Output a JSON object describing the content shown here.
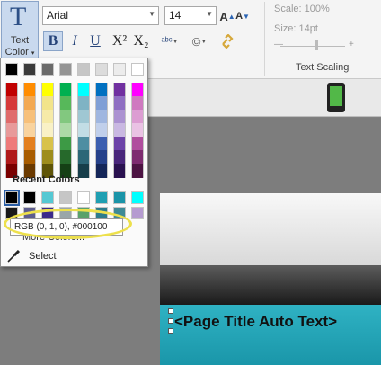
{
  "ribbon": {
    "text_color_label_line1": "Text",
    "text_color_label_line2": "Color",
    "text_color_glyph": "T",
    "font_name": "Arial",
    "font_size": "14",
    "grow_font": "A",
    "shrink_font": "A",
    "bold": "B",
    "italic": "I",
    "underline": "U",
    "superscript": "X²",
    "subscript": "X₂",
    "spellcheck_glyph": "ᵃᵇᶜ",
    "copyright_glyph": "©",
    "link_icon": "link-icon"
  },
  "text_scaling": {
    "scale": "Scale: 100%",
    "size": "Size: 14pt",
    "group_label": "Text Scaling"
  },
  "palette": {
    "grays": [
      "#000000",
      "#3a3a3a",
      "#6a6a6a",
      "#949494",
      "#c6c6c6",
      "#dcdcdc",
      "#ececec",
      "#ffffff"
    ],
    "hues": [
      [
        "#c00000",
        "#d63a3a",
        "#e06c6c",
        "#e89a9a",
        "#ee7a7a",
        "#b01a1a",
        "#7a0000"
      ],
      [
        "#ff8c00",
        "#f3a952",
        "#f7c07a",
        "#f9d39e",
        "#e37f1f",
        "#a85c00",
        "#6b3a00"
      ],
      [
        "#ffff00",
        "#f2e48a",
        "#f6eaa8",
        "#f9f1c6",
        "#d8c24b",
        "#9e8d1d",
        "#5f5508"
      ],
      [
        "#00b050",
        "#57b85a",
        "#82c87f",
        "#acdaa6",
        "#3d9a45",
        "#26692b",
        "#154015"
      ],
      [
        "#00ffff",
        "#7fb3c4",
        "#9fc7d3",
        "#c2dde5",
        "#4e8ea2",
        "#2c6677",
        "#163e4a"
      ],
      [
        "#0070c0",
        "#7f9fd6",
        "#9fb6e0",
        "#c0cfeb",
        "#3c5fb0",
        "#25418a",
        "#142659"
      ],
      [
        "#7030a0",
        "#8f6fc2",
        "#ab92d1",
        "#c9b8e2",
        "#6c43a8",
        "#49267b",
        "#2a1250"
      ],
      [
        "#ff00ff",
        "#cf79c0",
        "#dc9dd2",
        "#eac2e4",
        "#b04e9e",
        "#7e2c70",
        "#4d1443"
      ]
    ],
    "recent_label": "Recent Colors",
    "recent_row1": [
      "#000000",
      "#000000",
      "#55c8d3",
      "#c6c6c6",
      "#ffffff",
      "#1f9fb2",
      "#1b94a8",
      "#00ffff"
    ],
    "recent_row2": [
      "#1a1a1a",
      "#5d5d8e",
      "#3b2a8a",
      "#9aa6a8",
      "#5aa16a",
      "#2d7c8c",
      "#3e8a96",
      "#b59bd0"
    ],
    "tooltip": "RGB (0, 1, 0), #000100",
    "more_colors": "More Colors...",
    "select_label": "Select"
  },
  "slide": {
    "title": "<Page Title Auto Text>"
  }
}
